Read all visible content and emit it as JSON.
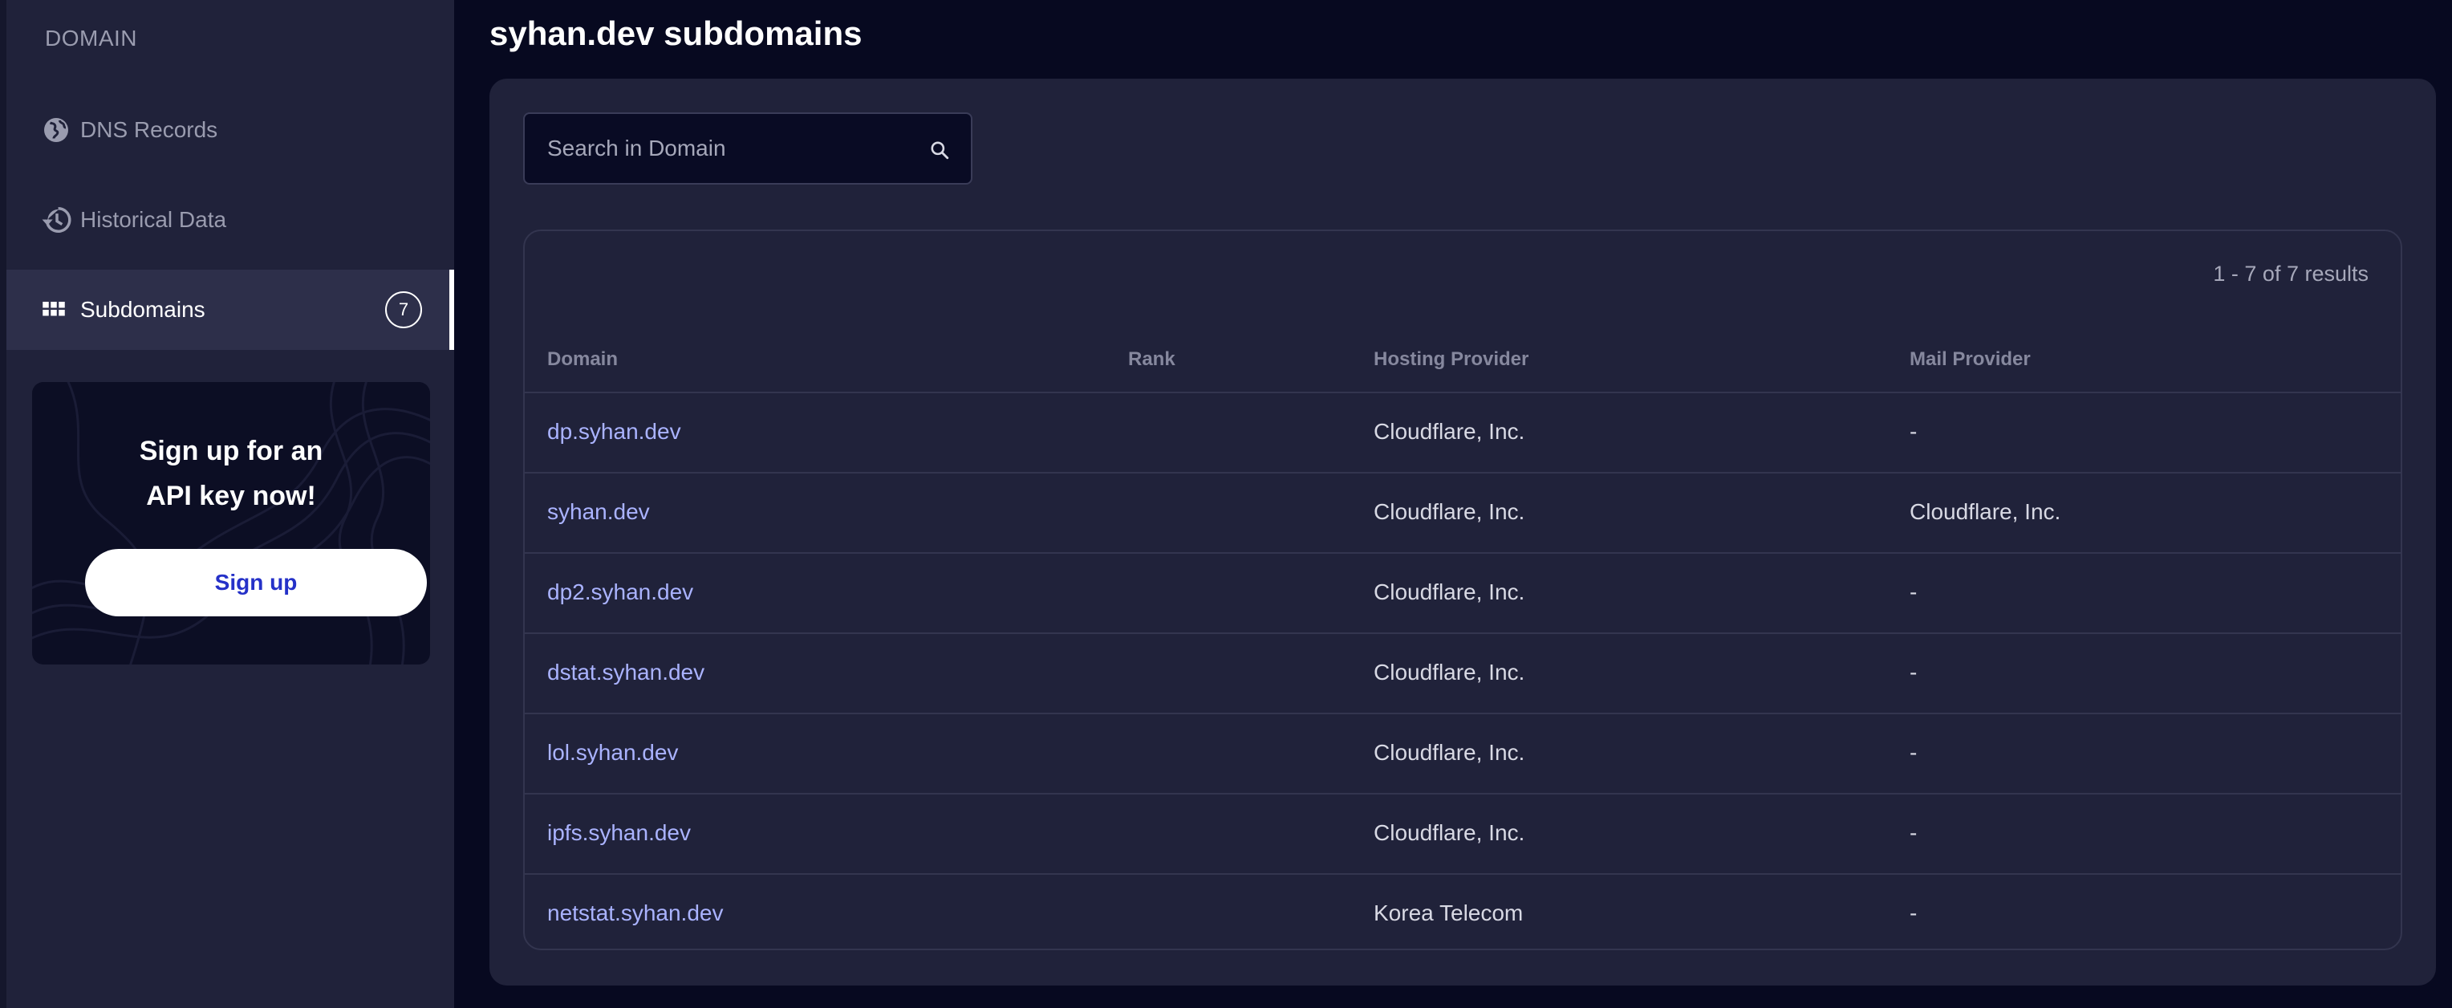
{
  "sidebar": {
    "heading": "DOMAIN",
    "items": [
      {
        "label": "DNS Records",
        "icon": "globe-icon"
      },
      {
        "label": "Historical Data",
        "icon": "history-icon"
      },
      {
        "label": "Subdomains",
        "icon": "grid-icon",
        "badge": "7",
        "active": true
      }
    ]
  },
  "promo": {
    "title_line1": "Sign up for an",
    "title_line2": "API key now!",
    "button_label": "Sign up"
  },
  "page": {
    "title": "syhan.dev subdomains"
  },
  "search": {
    "placeholder": "Search in Domain"
  },
  "table": {
    "results": "1 - 7 of 7 results",
    "headers": {
      "domain": "Domain",
      "rank": "Rank",
      "hosting": "Hosting Provider",
      "mail": "Mail Provider"
    },
    "rows": [
      {
        "domain": "dp.syhan.dev",
        "rank": "",
        "hosting": "Cloudflare, Inc.",
        "mail": "-"
      },
      {
        "domain": "syhan.dev",
        "rank": "",
        "hosting": "Cloudflare, Inc.",
        "mail": "Cloudflare, Inc."
      },
      {
        "domain": "dp2.syhan.dev",
        "rank": "",
        "hosting": "Cloudflare, Inc.",
        "mail": "-"
      },
      {
        "domain": "dstat.syhan.dev",
        "rank": "",
        "hosting": "Cloudflare, Inc.",
        "mail": "-"
      },
      {
        "domain": "lol.syhan.dev",
        "rank": "",
        "hosting": "Cloudflare, Inc.",
        "mail": "-"
      },
      {
        "domain": "ipfs.syhan.dev",
        "rank": "",
        "hosting": "Cloudflare, Inc.",
        "mail": "-"
      },
      {
        "domain": "netstat.syhan.dev",
        "rank": "",
        "hosting": "Korea Telecom",
        "mail": "-"
      }
    ]
  },
  "colors": {
    "background": "#070920",
    "panel": "#20223a",
    "link": "#aab3ff",
    "button_text": "#2531c8"
  }
}
